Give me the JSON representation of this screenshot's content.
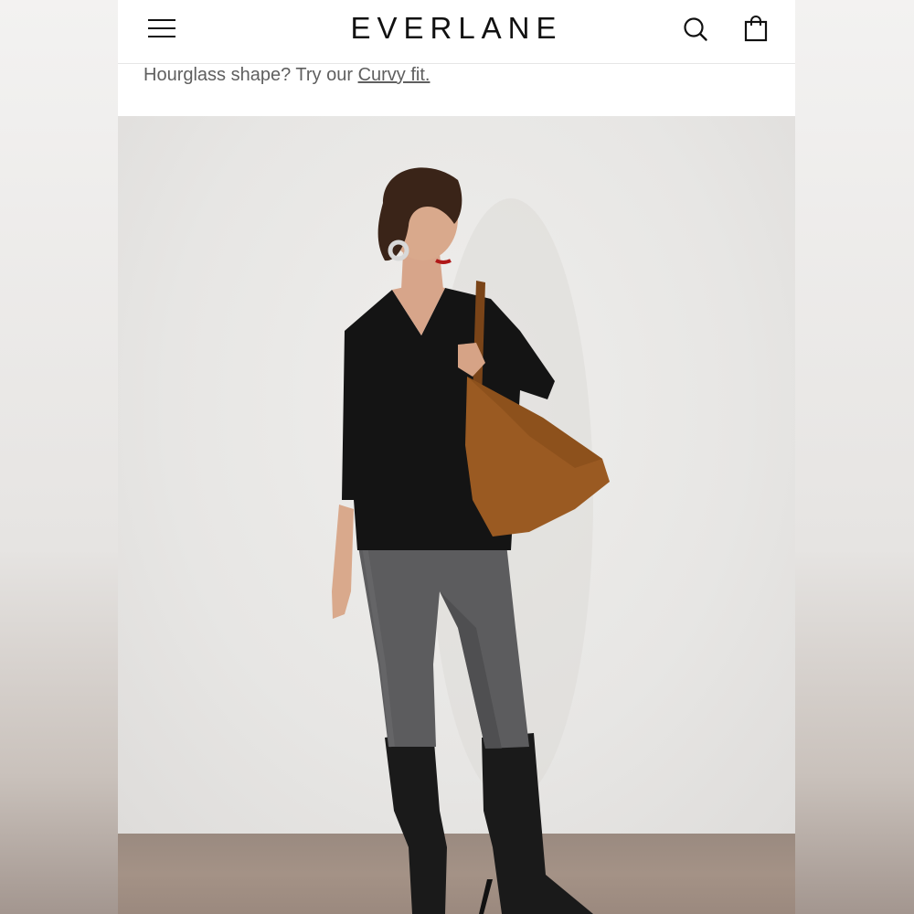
{
  "header": {
    "logo_text": "EVERLANE",
    "menu_icon": "hamburger-menu-icon",
    "search_icon": "search-icon",
    "bag_icon": "shopping-bag-icon"
  },
  "promo": {
    "text": "Hourglass shape? Try our ",
    "link_text": "Curvy fit."
  },
  "hero": {
    "image_description_icon": "model-photo",
    "colors": {
      "sweater": "#141414",
      "bag": "#9a5a22",
      "jeans": "#5c5c5e",
      "boots": "#1a1a1a"
    }
  }
}
